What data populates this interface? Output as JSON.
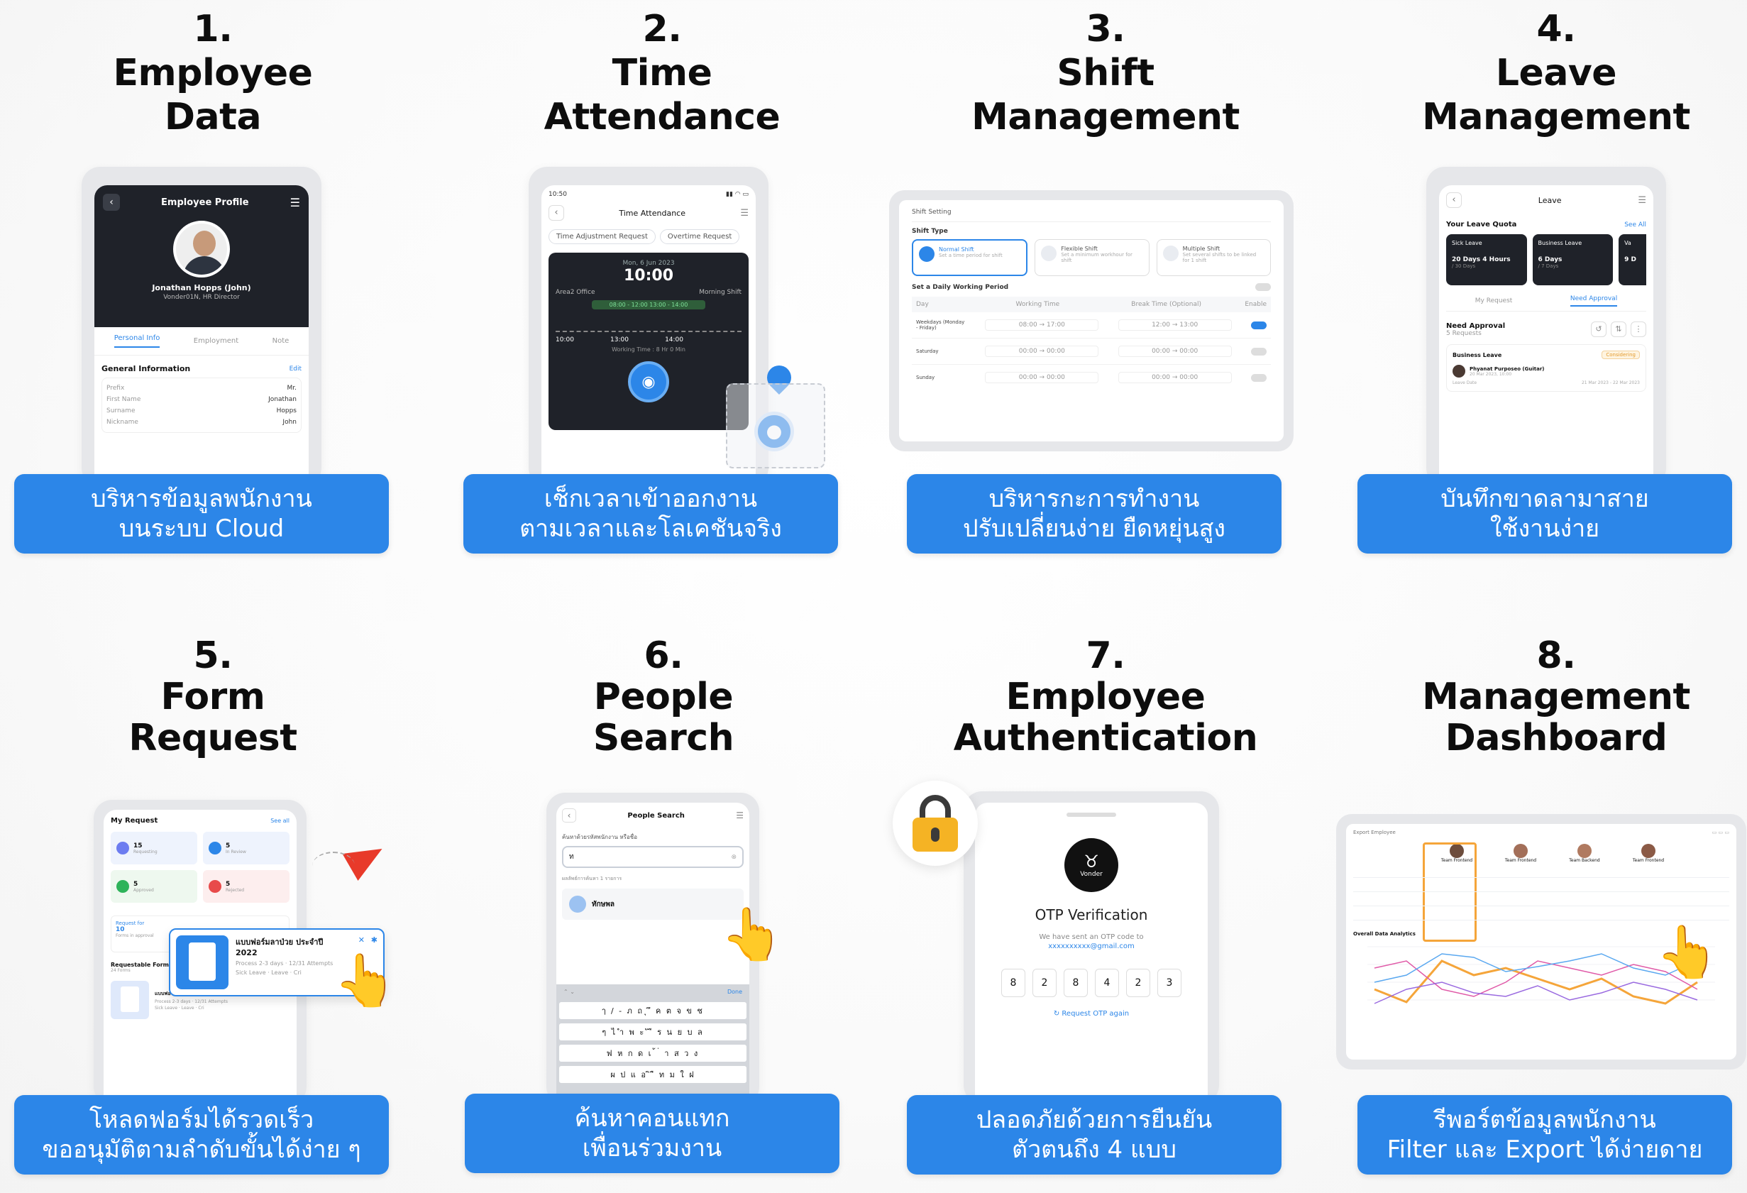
{
  "features": [
    {
      "number": "1.",
      "title_lines": [
        "Employee",
        "Data"
      ],
      "banner_lines": [
        "บริหารข้อมูลพนักงาน",
        "บนระบบ Cloud"
      ]
    },
    {
      "number": "2.",
      "title_lines": [
        "Time",
        "Attendance"
      ],
      "banner_lines": [
        "เช็กเวลาเข้าออกงาน",
        "ตามเวลาและโลเคชันจริง"
      ]
    },
    {
      "number": "3.",
      "title_lines": [
        "Shift",
        "Management"
      ],
      "banner_lines": [
        "บริหารกะการทำงาน",
        "ปรับเปลี่ยนง่าย ยืดหยุ่นสูง"
      ]
    },
    {
      "number": "4.",
      "title_lines": [
        "Leave",
        "Management"
      ],
      "banner_lines": [
        "บันทึกขาดลามาสาย",
        "ใช้งานง่าย"
      ]
    },
    {
      "number": "5.",
      "title_lines": [
        "Form",
        "Request"
      ],
      "banner_lines": [
        "โหลดฟอร์มได้รวดเร็ว",
        "ขออนุมัติตามลำดับขั้นได้ง่าย ๆ"
      ]
    },
    {
      "number": "6.",
      "title_lines": [
        "People",
        "Search"
      ],
      "banner_lines": [
        "ค้นหาคอนแทก",
        "เพื่อนร่วมงาน"
      ]
    },
    {
      "number": "7.",
      "title_lines": [
        "Employee",
        "Authentication"
      ],
      "banner_lines": [
        "ปลอดภัยด้วยการยืนยัน",
        "ตัวตนถึง 4 แบบ"
      ]
    },
    {
      "number": "8.",
      "title_lines": [
        "Management",
        "Dashboard"
      ],
      "banner_lines": [
        "รีพอร์ตข้อมูลพนักงาน",
        "Filter และ Export ได้ง่ายดาย"
      ]
    }
  ],
  "screens": {
    "employee_profile": {
      "header": "Employee Profile",
      "name": "Jonathan Hopps (John)",
      "role": "Vonder01N, HR Director",
      "tabs": [
        "Personal Info",
        "Employment",
        "Note"
      ],
      "section": "General Information",
      "edit": "Edit",
      "fields": [
        {
          "label": "Prefix",
          "value": "Mr."
        },
        {
          "label": "First Name",
          "value": "Jonathan"
        },
        {
          "label": "Surname",
          "value": "Hopps"
        },
        {
          "label": "Nickname",
          "value": "John"
        }
      ]
    },
    "time_attendance": {
      "status_time": "10:50",
      "header": "Time Attendance",
      "chips": [
        "Time Adjustment Request",
        "Overtime Request"
      ],
      "date": "Mon, 6 Jun 2023",
      "clock": "10:00",
      "office": "Area2 Office",
      "shift": "Morning Shift",
      "schedule": "08:00 - 12:00 13:00 - 14:00",
      "times": [
        "10:00",
        "13:00",
        "14:00"
      ],
      "working": "Working Time : 8 Hr 0 Min"
    },
    "shift_setting": {
      "header": "Shift Setting",
      "type_label": "Shift Type",
      "types": [
        {
          "name": "Normal Shift",
          "desc": "Set a time period for shift"
        },
        {
          "name": "Flexible Shift",
          "desc": "Set a minimum workhour for shift"
        },
        {
          "name": "Multiple Shift",
          "desc": "Set several shifts to be linked for 1 shift"
        }
      ],
      "period_label": "Set a Daily Working Period",
      "columns": [
        "Day",
        "Working Time",
        "Break Time (Optional)",
        "Enable"
      ],
      "rows": [
        {
          "day": "Weekdays (Monday - Friday)",
          "start": "08:00",
          "end": "17:00",
          "bstart": "12:00",
          "bend": "13:00"
        },
        {
          "day": "Saturday",
          "start": "00:00",
          "end": "00:00",
          "bstart": "00:00",
          "bend": "00:00"
        },
        {
          "day": "Sunday",
          "start": "00:00",
          "end": "00:00",
          "bstart": "00:00",
          "bend": "00:00"
        }
      ]
    },
    "leave": {
      "header": "Leave",
      "quota_label": "Your Leave Quota",
      "see_all": "See All",
      "quotas": [
        {
          "name": "Sick Leave",
          "amount": "20 Days 4 Hours",
          "total": "/ 30 Days"
        },
        {
          "name": "Business Leave",
          "amount": "6 Days",
          "total": "/ 7 Days"
        },
        {
          "name": "Va",
          "amount": "9 D",
          "total": ""
        }
      ],
      "tabs": [
        "My Request",
        "Need Approval"
      ],
      "need_label": "Need Approval",
      "count": "5 Requests",
      "item_type": "Business Leave",
      "item_status": "Considering",
      "person": "Phyanat Purposeo (Guitar)",
      "person_date": "20 Mar 2023, 10:00",
      "leave_date_label": "Leave Date",
      "leave_date": "21 Mar 2023 - 22 Mar 2023"
    },
    "form_request": {
      "header": "My Request",
      "see_all": "See all",
      "stats": [
        {
          "count": "15",
          "label": "Requesting"
        },
        {
          "count": "5",
          "label": "In Review"
        },
        {
          "count": "5",
          "label": "Approved"
        },
        {
          "count": "5",
          "label": "Rejected"
        }
      ],
      "popup_title": "แบบฟอร์มลาป่วย ประจำปี 2022",
      "popup_process": "Process 2-3 days",
      "popup_attempts": "12/31 Attempts",
      "popup_tags": [
        "Sick Leave",
        "Leave",
        "Cri"
      ],
      "request_for": "Request for",
      "request_count": "10",
      "request_label": "Forms in approval",
      "requestable_label": "Requestable Form",
      "requestable_count": "24 Forms",
      "form_title": "แบบฟอร์มลาป่วย ประจำปี 2022",
      "form_process": "Process 2-3 days",
      "form_attempts": "12/31 Attempts",
      "form_tags": [
        "Sick Leave",
        "Leave",
        "Cri"
      ]
    },
    "people_search": {
      "header": "People Search",
      "prompt": "ค้นหาด้วยรหัสพนักงาน หรือชื่อ",
      "query": "ท",
      "results_label": "ผลลัพธ์การค้นหา 1 รายการ",
      "result_name": "ทักษพล",
      "keyboard_done": "Done",
      "keyboard_rows": [
        "ๅ / - ภ ถ ุ ึ ค ต จ ข ช",
        "ๆ ไ ำ พ ะ ั ี ร น ย บ ล",
        "ฟ ห ก ด เ ้ ่ า ส ว ง",
        "ผ ป แ อ ิ ื ท ม ใ ฝ"
      ]
    },
    "otp": {
      "brand": "Vonder",
      "title": "OTP Verification",
      "sent_line": "We have sent an OTP code to",
      "email": "xxxxxxxxxx@gmail.com",
      "digits": [
        "8",
        "2",
        "8",
        "4",
        "2",
        "3"
      ],
      "resend": "Request OTP again"
    },
    "dashboard": {
      "header": "Export Employee",
      "teams": [
        "Team Frontend",
        "Team Frontend",
        "Team Backend",
        "Team Frontend"
      ],
      "chart_label": "Overall Data Analytics"
    }
  },
  "colors": {
    "banner": "#2c86e8",
    "accent_orange": "#f5a53a",
    "dark_screen": "#1f2229"
  }
}
